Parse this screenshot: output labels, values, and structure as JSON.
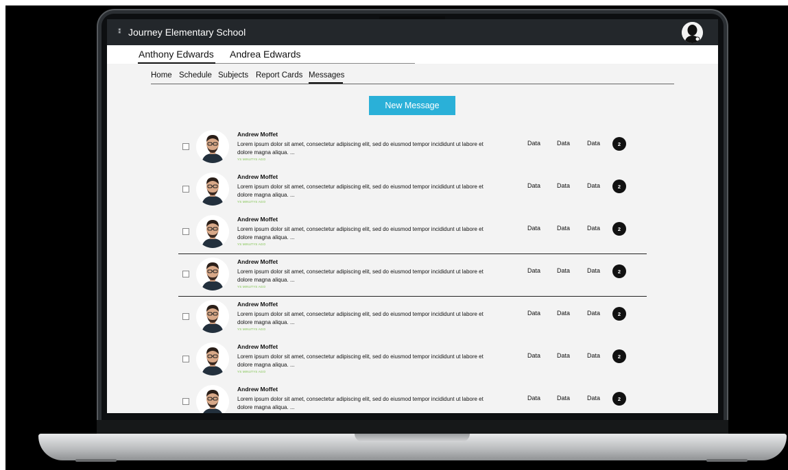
{
  "topbar": {
    "school_name": "Journey Elementary School"
  },
  "students": [
    "Anthony Edwards",
    "Andrea Edwards"
  ],
  "nav": [
    "Home",
    "Schedule",
    "Subjects",
    "Report Cards",
    "Messages"
  ],
  "new_message_label": "New Message",
  "messages": [
    {
      "name": "Andrew Moffet",
      "text": "Lorem ipsum dolor sit amet, consectetur adipiscing elit, sed do eiusmod tempor incididunt ut labore et dolore magna aliqua. ...",
      "time": "YS MINUTYS AGO",
      "d1": "Data",
      "d2": "Data",
      "d3": "Data",
      "badge": "2"
    },
    {
      "name": "Andrew Moffet",
      "text": "Lorem ipsum dolor sit amet, consectetur adipiscing elit, sed do eiusmod tempor incididunt ut labore et dolore magna aliqua. ...",
      "time": "YS MINUTYS AGO",
      "d1": "Data",
      "d2": "Data",
      "d3": "Data",
      "badge": "2"
    },
    {
      "name": "Andrew Moffet",
      "text": "Lorem ipsum dolor sit amet, consectetur adipiscing elit, sed do eiusmod tempor incididunt ut labore et dolore magna aliqua. ...",
      "time": "YS MINUTYS AGO",
      "d1": "Data",
      "d2": "Data",
      "d3": "Data",
      "badge": "2"
    },
    {
      "name": "Andrew Moffet",
      "text": "Lorem ipsum dolor sit amet, consectetur adipiscing elit, sed do eiusmod tempor incididunt ut labore et dolore magna aliqua. ...",
      "time": "YS MINUTYS AGO",
      "d1": "Data",
      "d2": "Data",
      "d3": "Data",
      "badge": "2"
    },
    {
      "name": "Andrew Moffet",
      "text": "Lorem ipsum dolor sit amet, consectetur adipiscing elit, sed do eiusmod tempor incididunt ut labore et dolore magna aliqua. ...",
      "time": "YS MINUTYS AGO",
      "d1": "Data",
      "d2": "Data",
      "d3": "Data",
      "badge": "2"
    },
    {
      "name": "Andrew Moffet",
      "text": "Lorem ipsum dolor sit amet, consectetur adipiscing elit, sed do eiusmod tempor incididunt ut labore et dolore magna aliqua. ...",
      "time": "YS MINUTYS AGO",
      "d1": "Data",
      "d2": "Data",
      "d3": "Data",
      "badge": "2"
    },
    {
      "name": "Andrew Moffet",
      "text": "Lorem ipsum dolor sit amet, consectetur adipiscing elit, sed do eiusmod tempor incididunt ut labore et dolore magna aliqua. ...",
      "time": "",
      "d1": "Data",
      "d2": "Data",
      "d3": "Data",
      "badge": "2"
    }
  ],
  "colors": {
    "accent": "#2ab0d8",
    "timestamp": "#7cc24a",
    "topbar": "#23272b",
    "badge": "#111111"
  },
  "icons": {
    "avatar": "person-avatar-icon",
    "checkbox": "checkbox-icon",
    "menu": "dots-icon"
  }
}
